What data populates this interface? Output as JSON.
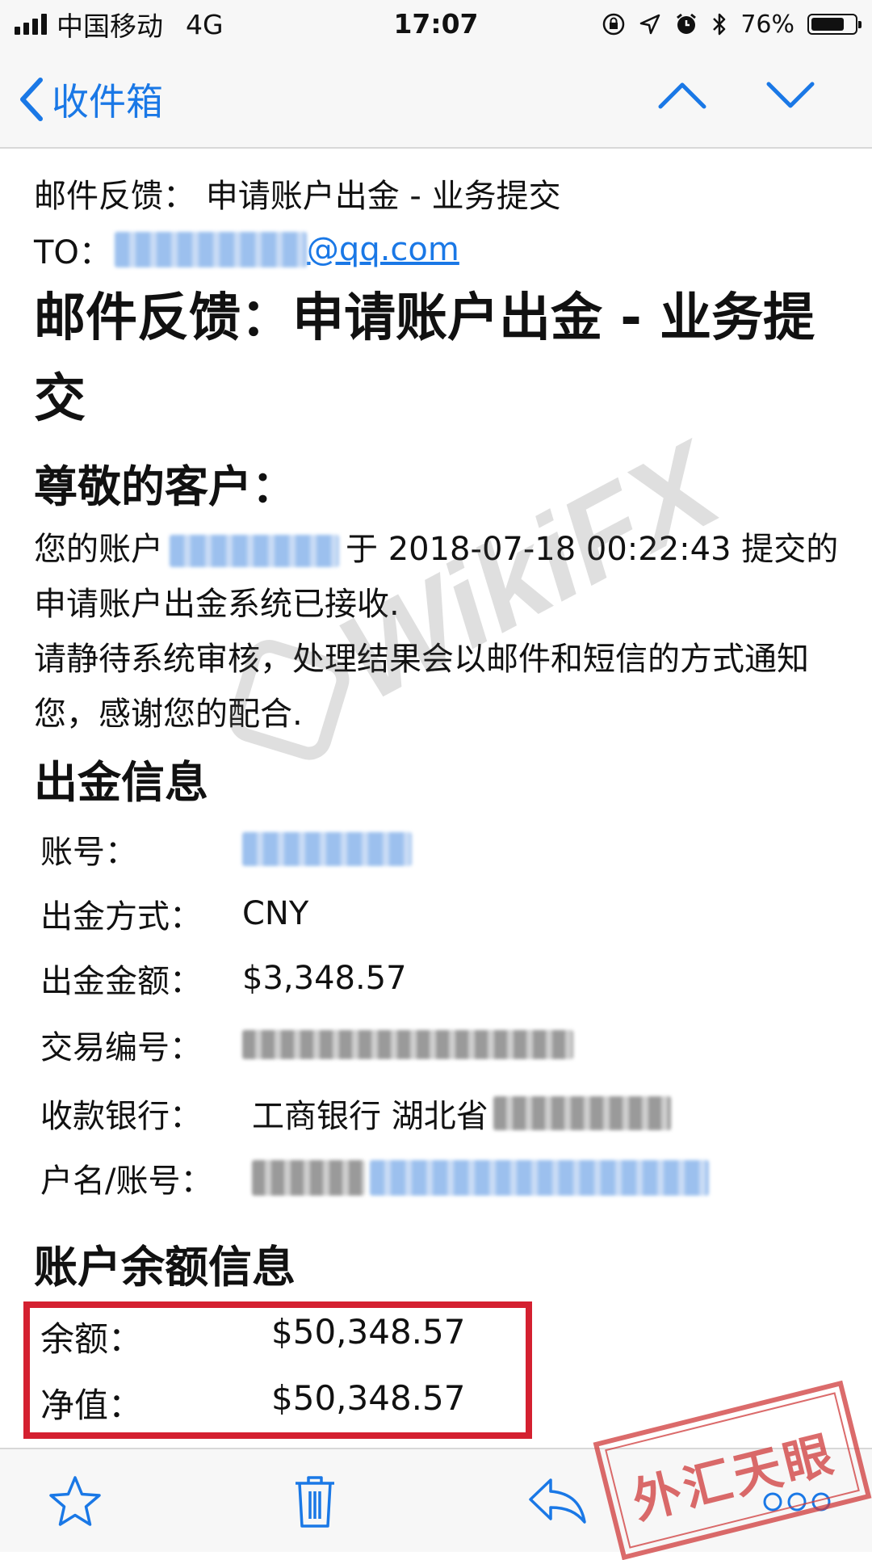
{
  "status_bar": {
    "carrier": "中国移动",
    "network": "4G",
    "time": "17:07",
    "battery_percent": "76%",
    "battery_level": 0.76
  },
  "nav": {
    "back_label": "收件箱"
  },
  "email": {
    "subject": "邮件反馈： 申请账户出金 - 业务提交",
    "to_label": "TO：",
    "to_domain": "@qq.com",
    "title": "邮件反馈：申请账户出金 - 业务提交",
    "greeting": "尊敬的客户：",
    "body_prefix": "您的账户",
    "body_suffix": "于 2018-07-18 00:22:43 提交的申请账户出金系统已接收.",
    "body_line2": "请静待系统审核，处理结果会以邮件和短信的方式通知您，感谢您的配合."
  },
  "withdrawal": {
    "heading": "出金信息",
    "account_label": "账号：",
    "method_label": "出金方式：",
    "method_value": "CNY",
    "amount_label": "出金金额：",
    "amount_value": "$3,348.57",
    "txn_label": "交易编号：",
    "bank_label": "收款银行：",
    "bank_value": "工商银行 湖北省",
    "holder_label": "户名/账号："
  },
  "balance": {
    "heading": "账户余额信息",
    "balance_label": "余额：",
    "balance_value": "$50,348.57",
    "equity_label": "净值：",
    "equity_value": "$50,348.57"
  },
  "watermark": {
    "text": "WikiFX",
    "stamp_text": "外汇天眼"
  },
  "colors": {
    "accent": "#1a78e6",
    "highlight_box": "#d42030"
  }
}
